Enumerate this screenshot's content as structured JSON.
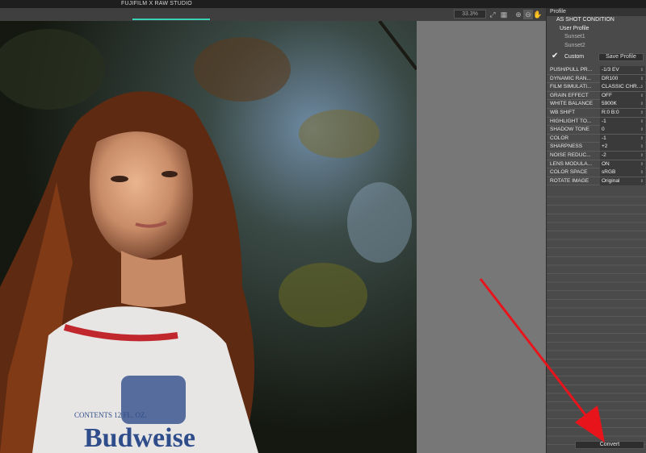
{
  "window": {
    "title": "FUJIFILM X RAW STUDIO"
  },
  "toolbar": {
    "zoom_level": "33.3%",
    "icons": [
      "fit-icon",
      "zoom-in-icon",
      "zoom-out-icon",
      "hand-icon"
    ],
    "progress_color": "#3ad1b4"
  },
  "panel": {
    "header": "Profile",
    "profiles": {
      "as_shot": "AS SHOT CONDITION",
      "user_profile": "User Profile",
      "items": [
        "Sunset1",
        "Sunset2"
      ]
    },
    "custom_label": "Custom",
    "save_profile_label": "Save Profile",
    "settings": [
      {
        "label": "PUSH/PULL PR...",
        "value": "-1/3 EV"
      },
      {
        "label": "DYNAMIC RAN...",
        "value": "DR100"
      },
      {
        "label": "FILM SIMULATI...",
        "value": "CLASSIC CHR..."
      },
      {
        "label": "GRAIN EFFECT",
        "value": "OFF"
      },
      {
        "label": "WHITE BALANCE",
        "value": "5900K"
      },
      {
        "label": "WB SHIFT",
        "value": "R:0 B:0"
      },
      {
        "label": "HIGHLIGHT TO...",
        "value": "-1"
      },
      {
        "label": "SHADOW TONE",
        "value": "0"
      },
      {
        "label": "COLOR",
        "value": "-1"
      },
      {
        "label": "SHARPNESS",
        "value": "+2"
      },
      {
        "label": "NOISE REDUC...",
        "value": "-2"
      },
      {
        "label": "LENS MODULA...",
        "value": "ON"
      },
      {
        "label": "COLOR SPACE",
        "value": "sRGB"
      },
      {
        "label": "ROTATE IMAGE",
        "value": "Original"
      }
    ],
    "convert_label": "Convert"
  },
  "photo": {
    "shirt_text_small": "CONTENTS 12 FL. OZ.",
    "shirt_text_brand": "Budweise"
  },
  "colors": {
    "arrow": "#e8141c",
    "accent": "#3ad1b4"
  }
}
